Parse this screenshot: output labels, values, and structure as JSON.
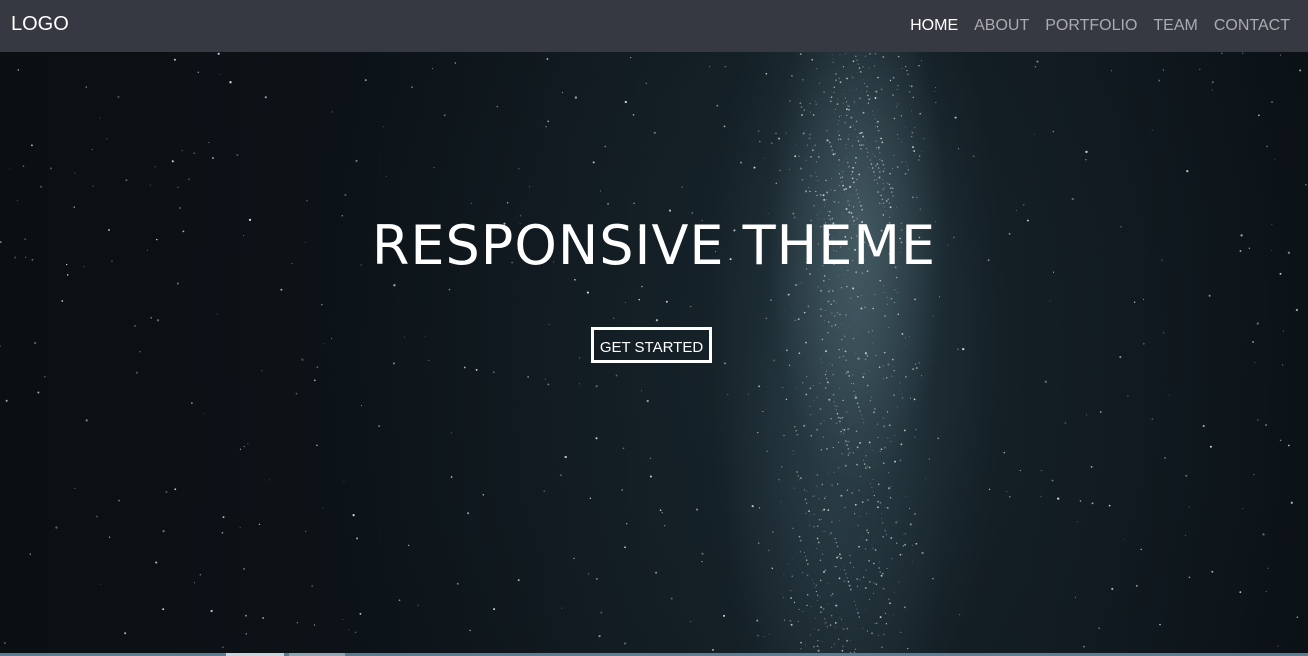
{
  "navbar": {
    "logo": "LOGO",
    "items": [
      {
        "label": "HOME",
        "active": true
      },
      {
        "label": "ABOUT",
        "active": false
      },
      {
        "label": "PORTFOLIO",
        "active": false
      },
      {
        "label": "TEAM",
        "active": false
      },
      {
        "label": "CONTACT",
        "active": false
      }
    ]
  },
  "hero": {
    "title": "RESPONSIVE THEME",
    "cta_label": "GET STARTED",
    "background": "starry-night-milky-way"
  },
  "colors": {
    "navbar_bg": "#363941",
    "nav_inactive": "#a9abb0",
    "nav_active": "#ffffff",
    "hero_bg": "#0b1116",
    "text": "#ffffff"
  }
}
